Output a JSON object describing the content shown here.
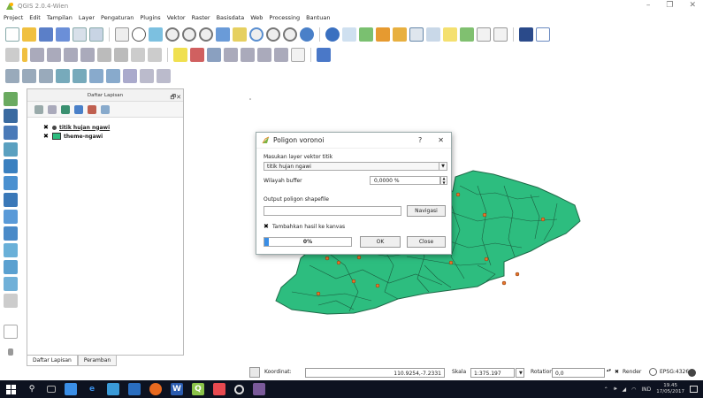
{
  "window": {
    "title": "QGIS 2.0.4-Wien",
    "min": "–",
    "max": "❐",
    "close": "✕"
  },
  "menu": [
    "Project",
    "Edit",
    "Tampilan",
    "Layer",
    "Pengaturan",
    "Plugins",
    "Vektor",
    "Raster",
    "Basisdata",
    "Web",
    "Processing",
    "Bantuan"
  ],
  "layers_panel": {
    "title": "Daftar Lapisan",
    "controls": "🗗✕",
    "layers": [
      {
        "name": "titik hujan ngawi",
        "checked": "✖"
      },
      {
        "name": "theme-ngawi",
        "checked": "✖"
      }
    ]
  },
  "tabs": [
    "Daftar Lapisan",
    "Peramban"
  ],
  "dialog": {
    "title": "Poligon voronoi",
    "help": "?",
    "close": "✕",
    "input_label": "Masukan layer vektor titik",
    "input_value": "titik hujan ngawi",
    "buffer_label": "Wilayah buffer",
    "buffer_value": "0,0000 %",
    "output_label": "Output poligon shapefile",
    "browse_label": "Navigasi",
    "add_to_canvas_label": "Tambahkan hasil ke kanvas",
    "add_to_canvas_check": "✖",
    "progress_text": "0%",
    "progress": 0.05,
    "ok_label": "OK",
    "close_label": "Close"
  },
  "status": {
    "coord_label": "Koordinat:",
    "coord_value": "110.9254,-7.2331",
    "scale_label": "Skala",
    "scale_value": "1:375.197",
    "rotation_label": "Rotation:",
    "rotation_value": "0,0",
    "render_label": "Render",
    "crs_label": "EPSG:4326"
  },
  "taskbar": {
    "tray_text": "IND",
    "time": "19.45",
    "date": "17/05/2017"
  },
  "colors": {
    "polygon": "#2dbd7f",
    "point": "#e8742b",
    "accent": "#3a8ee6"
  }
}
